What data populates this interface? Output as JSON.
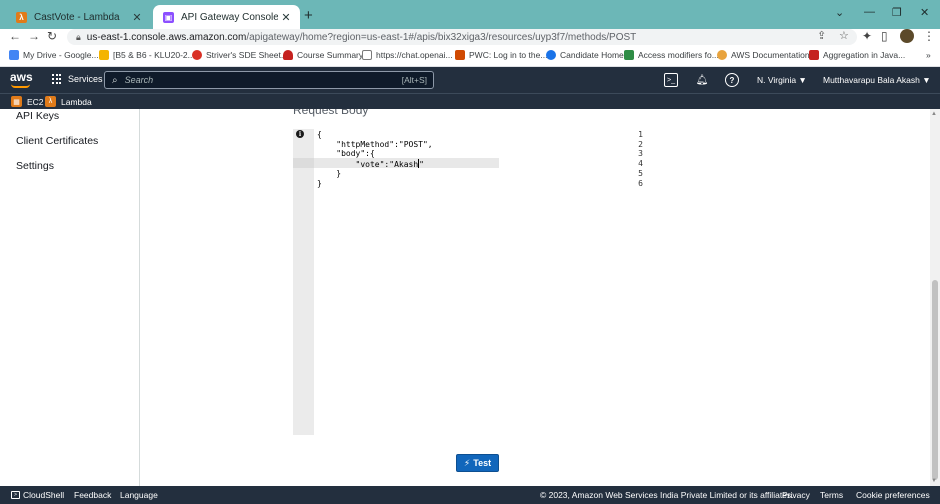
{
  "browser": {
    "tabs": [
      {
        "title": "CastVote - Lambda",
        "icon_color": "#e07b1a"
      },
      {
        "title": "API Gateway Console",
        "icon_color": "#8c4fff"
      }
    ],
    "new_tab": "+",
    "window_controls": {
      "minimize": "—",
      "restore": "❐",
      "close": "✕",
      "menu": "⌄"
    },
    "url_host": "us-east-1.console.aws.amazon.com",
    "url_path": "/apigateway/home?region=us-east-1#/apis/bix32xiga3/resources/uyp3f7/methods/POST",
    "bookmarks": [
      {
        "label": "My Drive - Google...",
        "color": "#4285f4"
      },
      {
        "label": "[B5 & B6 - KLU20-2...",
        "color": "#f4b400"
      },
      {
        "label": "Striver's SDE Sheet...",
        "color": "#d93025"
      },
      {
        "label": "Course Summary",
        "color": "#c5221f"
      },
      {
        "label": "https://chat.openai...",
        "color": "#7a7a7a"
      },
      {
        "label": "PWC: Log in to the...",
        "color": "#d04a02"
      },
      {
        "label": "Candidate Home",
        "color": "#1a73e8"
      },
      {
        "label": "Access modifiers fo...",
        "color": "#2f8d46"
      },
      {
        "label": "AWS Documentation",
        "color": "#e8a33d"
      },
      {
        "label": "Aggregation in Java...",
        "color": "#c5221f"
      }
    ],
    "more_bookmarks": "»"
  },
  "aws_nav": {
    "logo": "aws",
    "services_label": "Services",
    "search_placeholder": "Search",
    "search_shortcut": "[Alt+S]",
    "region": "N. Virginia ▼",
    "account": "Mutthavarapu Bala Akash ▼",
    "favorites": [
      {
        "label": "EC2"
      },
      {
        "label": "Lambda"
      }
    ]
  },
  "sidebar": {
    "items": [
      {
        "label": "API Keys"
      },
      {
        "label": "Client Certificates"
      },
      {
        "label": "Settings"
      }
    ]
  },
  "editor": {
    "heading": "Request Body",
    "line_numbers": [
      "1",
      "2",
      "3",
      "4",
      "5",
      "6"
    ],
    "lines": [
      "{",
      "    \"httpMethod\":\"POST\",",
      "    \"body\":{",
      "        \"vote\":\"Akash",
      "    }",
      "}"
    ],
    "active_line": 4,
    "line4_tail": "\""
  },
  "test_button": {
    "label": "Test"
  },
  "footer": {
    "cloudshell": "CloudShell",
    "feedback": "Feedback",
    "language": "Language",
    "copyright": "© 2023, Amazon Web Services India Private Limited or its affiliates.",
    "privacy": "Privacy",
    "terms": "Terms",
    "cookie": "Cookie preferences"
  }
}
